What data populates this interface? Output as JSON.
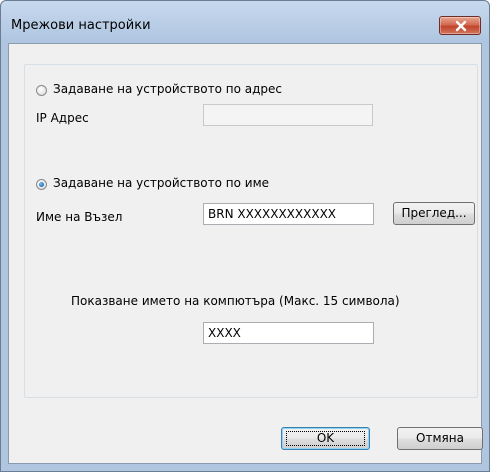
{
  "window": {
    "title": "Мрежови настройки",
    "close_icon": "close-x-icon",
    "accent_close": "#c7492f"
  },
  "address_option": {
    "radio_label": "Задаване на устройството по адрес",
    "selected": false,
    "ip_label": "IP Адрес",
    "ip_value": ""
  },
  "name_option": {
    "radio_label": "Задаване на устройството по име",
    "selected": true,
    "node_label": "Име на Възел",
    "node_value": "BRN XXXXXXXXXXXX",
    "browse_label": "Преглед..."
  },
  "computer_name": {
    "label": "Показване името на компютъра (Макс. 15 символа)",
    "value": "XXXX"
  },
  "buttons": {
    "ok_label": "OK",
    "cancel_label": "Отмяна"
  }
}
